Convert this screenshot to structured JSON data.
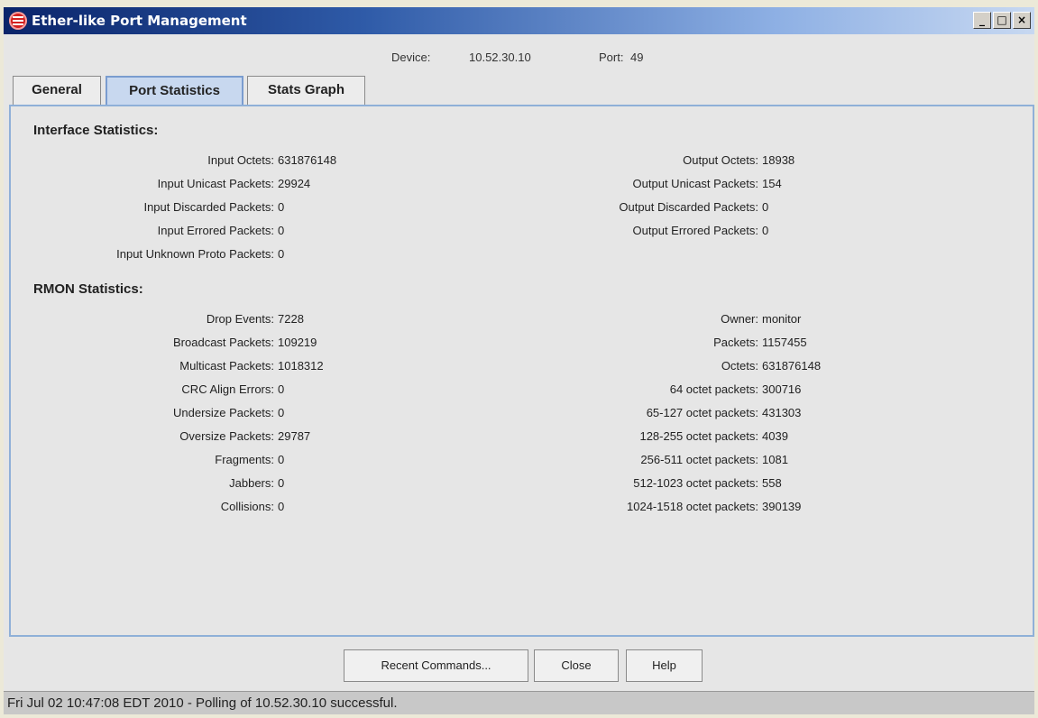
{
  "window": {
    "title": "Ether-like Port Management",
    "controls": [
      "_",
      "□",
      "×"
    ]
  },
  "header": {
    "device_label": "Device:",
    "device": "10.52.30.10",
    "port_label": "Port:",
    "port": "49"
  },
  "tabs": [
    {
      "label": "General",
      "active": false
    },
    {
      "label": "Port Statistics",
      "active": true
    },
    {
      "label": "Stats Graph",
      "active": false
    }
  ],
  "interface": {
    "title": "Interface Statistics:",
    "left": [
      {
        "label": "Input Octets:",
        "value": "631876148"
      },
      {
        "label": "Input Unicast Packets:",
        "value": "29924"
      },
      {
        "label": "Input Discarded Packets:",
        "value": "0"
      },
      {
        "label": "Input Errored Packets:",
        "value": "0"
      },
      {
        "label": "Input Unknown Proto Packets:",
        "value": "0"
      }
    ],
    "right": [
      {
        "label": "Output Octets:",
        "value": "18938"
      },
      {
        "label": "Output Unicast Packets:",
        "value": "154"
      },
      {
        "label": "Output Discarded Packets:",
        "value": "0"
      },
      {
        "label": "Output Errored Packets:",
        "value": "0"
      }
    ]
  },
  "rmon": {
    "title": "RMON Statistics:",
    "left": [
      {
        "label": "Drop Events:",
        "value": "7228"
      },
      {
        "label": "Broadcast Packets:",
        "value": "109219"
      },
      {
        "label": "Multicast Packets:",
        "value": "1018312"
      },
      {
        "label": "CRC Align Errors:",
        "value": "0"
      },
      {
        "label": "Undersize Packets:",
        "value": "0"
      },
      {
        "label": "Oversize Packets:",
        "value": "29787"
      },
      {
        "label": "Fragments:",
        "value": "0"
      },
      {
        "label": "Jabbers:",
        "value": "0"
      },
      {
        "label": "Collisions:",
        "value": "0"
      }
    ],
    "right": [
      {
        "label": "Owner:",
        "value": "monitor"
      },
      {
        "label": "Packets:",
        "value": "1157455"
      },
      {
        "label": "Octets:",
        "value": "631876148"
      },
      {
        "label": "64 octet packets:",
        "value": "300716"
      },
      {
        "label": "65-127 octet packets:",
        "value": "431303"
      },
      {
        "label": "128-255 octet packets:",
        "value": "4039"
      },
      {
        "label": "256-511 octet packets:",
        "value": "1081"
      },
      {
        "label": "512-1023 octet packets:",
        "value": "558"
      },
      {
        "label": "1024-1518 octet packets:",
        "value": "390139"
      }
    ]
  },
  "buttons": {
    "recent": "Recent Commands...",
    "close": "Close",
    "help": "Help"
  },
  "status": {
    "text": "Fri Jul 02 10:47:08 EDT 2010 - Polling of 10.52.30.10 successful."
  },
  "colors": {
    "title_bar_start": "#0a246a",
    "panel_border": "#8fb0d8",
    "active_tab": "#c8d8ef"
  }
}
